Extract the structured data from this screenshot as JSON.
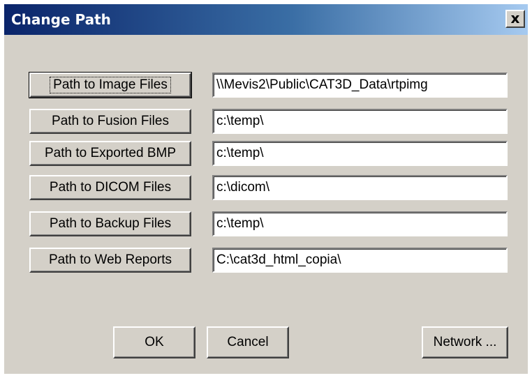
{
  "window": {
    "title": "Change Path",
    "close_glyph": "x"
  },
  "paths": [
    {
      "label": "Path to Image Files",
      "value": "\\\\Mevis2\\Public\\CAT3D_Data\\rtpimg"
    },
    {
      "label": "Path to Fusion Files",
      "value": "c:\\temp\\"
    },
    {
      "label": "Path to Exported BMP",
      "value": "c:\\temp\\"
    },
    {
      "label": "Path to DICOM Files",
      "value": "c:\\dicom\\"
    },
    {
      "label": "Path to Backup Files",
      "value": "c:\\temp\\"
    },
    {
      "label": "Path to Web Reports",
      "value": "C:\\cat3d_html_copia\\"
    }
  ],
  "footer": {
    "ok_label": "OK",
    "cancel_label": "Cancel",
    "network_label": "Network ..."
  },
  "colors": {
    "dialog_bg": "#d4d0c8",
    "title_start": "#0a246a",
    "title_end": "#a6caf0"
  }
}
